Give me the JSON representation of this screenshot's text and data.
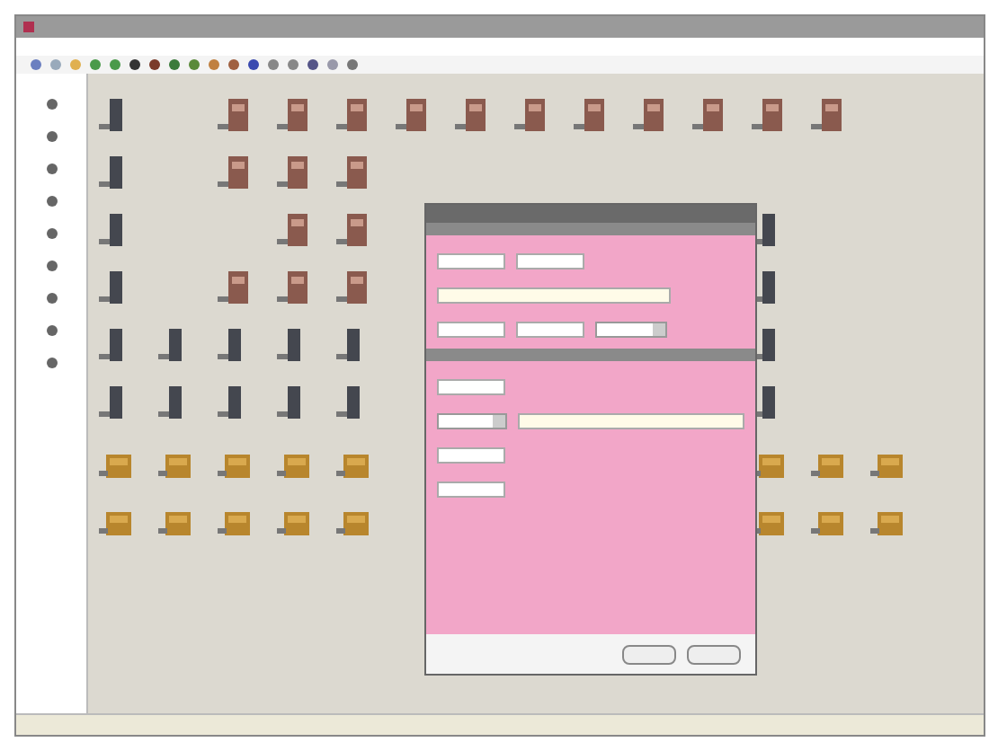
{
  "canvas": {
    "rows": [
      [
        {
          "kind": "tower"
        },
        null,
        {
          "kind": "unit"
        },
        {
          "kind": "unit"
        },
        {
          "kind": "unit"
        },
        {
          "kind": "unit"
        },
        {
          "kind": "unit"
        },
        {
          "kind": "unit"
        },
        {
          "kind": "unit"
        },
        {
          "kind": "unit"
        },
        {
          "kind": "unit"
        },
        {
          "kind": "unit"
        },
        {
          "kind": "unit"
        },
        null
      ],
      [
        {
          "kind": "tower"
        },
        null,
        {
          "kind": "unit"
        },
        {
          "kind": "unit"
        },
        {
          "kind": "unit"
        },
        null,
        null,
        null,
        null,
        null,
        null,
        null,
        null,
        null
      ],
      [
        {
          "kind": "tower"
        },
        null,
        null,
        {
          "kind": "unit"
        },
        {
          "kind": "unit"
        },
        null,
        null,
        null,
        null,
        null,
        null,
        {
          "kind": "tower"
        },
        null,
        null
      ],
      [
        {
          "kind": "tower"
        },
        null,
        {
          "kind": "unit"
        },
        {
          "kind": "unit"
        },
        {
          "kind": "unit"
        },
        null,
        null,
        null,
        null,
        null,
        null,
        {
          "kind": "tower"
        },
        null,
        null
      ],
      [
        {
          "kind": "tower"
        },
        {
          "kind": "tower"
        },
        {
          "kind": "tower"
        },
        {
          "kind": "tower"
        },
        {
          "kind": "tower"
        },
        null,
        null,
        null,
        null,
        null,
        null,
        {
          "kind": "tower"
        },
        null,
        null
      ],
      [
        {
          "kind": "tower"
        },
        {
          "kind": "tower"
        },
        {
          "kind": "tower"
        },
        {
          "kind": "tower"
        },
        {
          "kind": "tower"
        },
        null,
        null,
        null,
        null,
        null,
        null,
        {
          "kind": "tower"
        },
        null,
        null
      ],
      [
        {
          "kind": "crate"
        },
        {
          "kind": "crate"
        },
        {
          "kind": "crate"
        },
        {
          "kind": "crate"
        },
        {
          "kind": "crate"
        },
        null,
        null,
        null,
        null,
        null,
        null,
        {
          "kind": "crate"
        },
        {
          "kind": "crate"
        },
        {
          "kind": "crate"
        }
      ],
      [
        {
          "kind": "crate"
        },
        {
          "kind": "crate"
        },
        {
          "kind": "crate"
        },
        {
          "kind": "crate"
        },
        {
          "kind": "crate"
        },
        null,
        null,
        null,
        null,
        null,
        null,
        {
          "kind": "crate"
        },
        {
          "kind": "crate"
        },
        {
          "kind": "crate"
        }
      ]
    ]
  },
  "dialog": {
    "sections": [
      {
        "fields": [
          [
            {
              "kind": "input"
            },
            {
              "kind": "input"
            }
          ],
          [
            {
              "kind": "wide"
            }
          ],
          [
            {
              "kind": "input"
            },
            {
              "kind": "input"
            },
            {
              "kind": "select"
            }
          ]
        ]
      },
      {
        "fields": [
          [
            {
              "kind": "input"
            }
          ],
          [
            {
              "kind": "select"
            },
            {
              "kind": "wide"
            }
          ],
          [
            {
              "kind": "input"
            }
          ],
          [
            {
              "kind": "input"
            }
          ]
        ]
      }
    ]
  }
}
